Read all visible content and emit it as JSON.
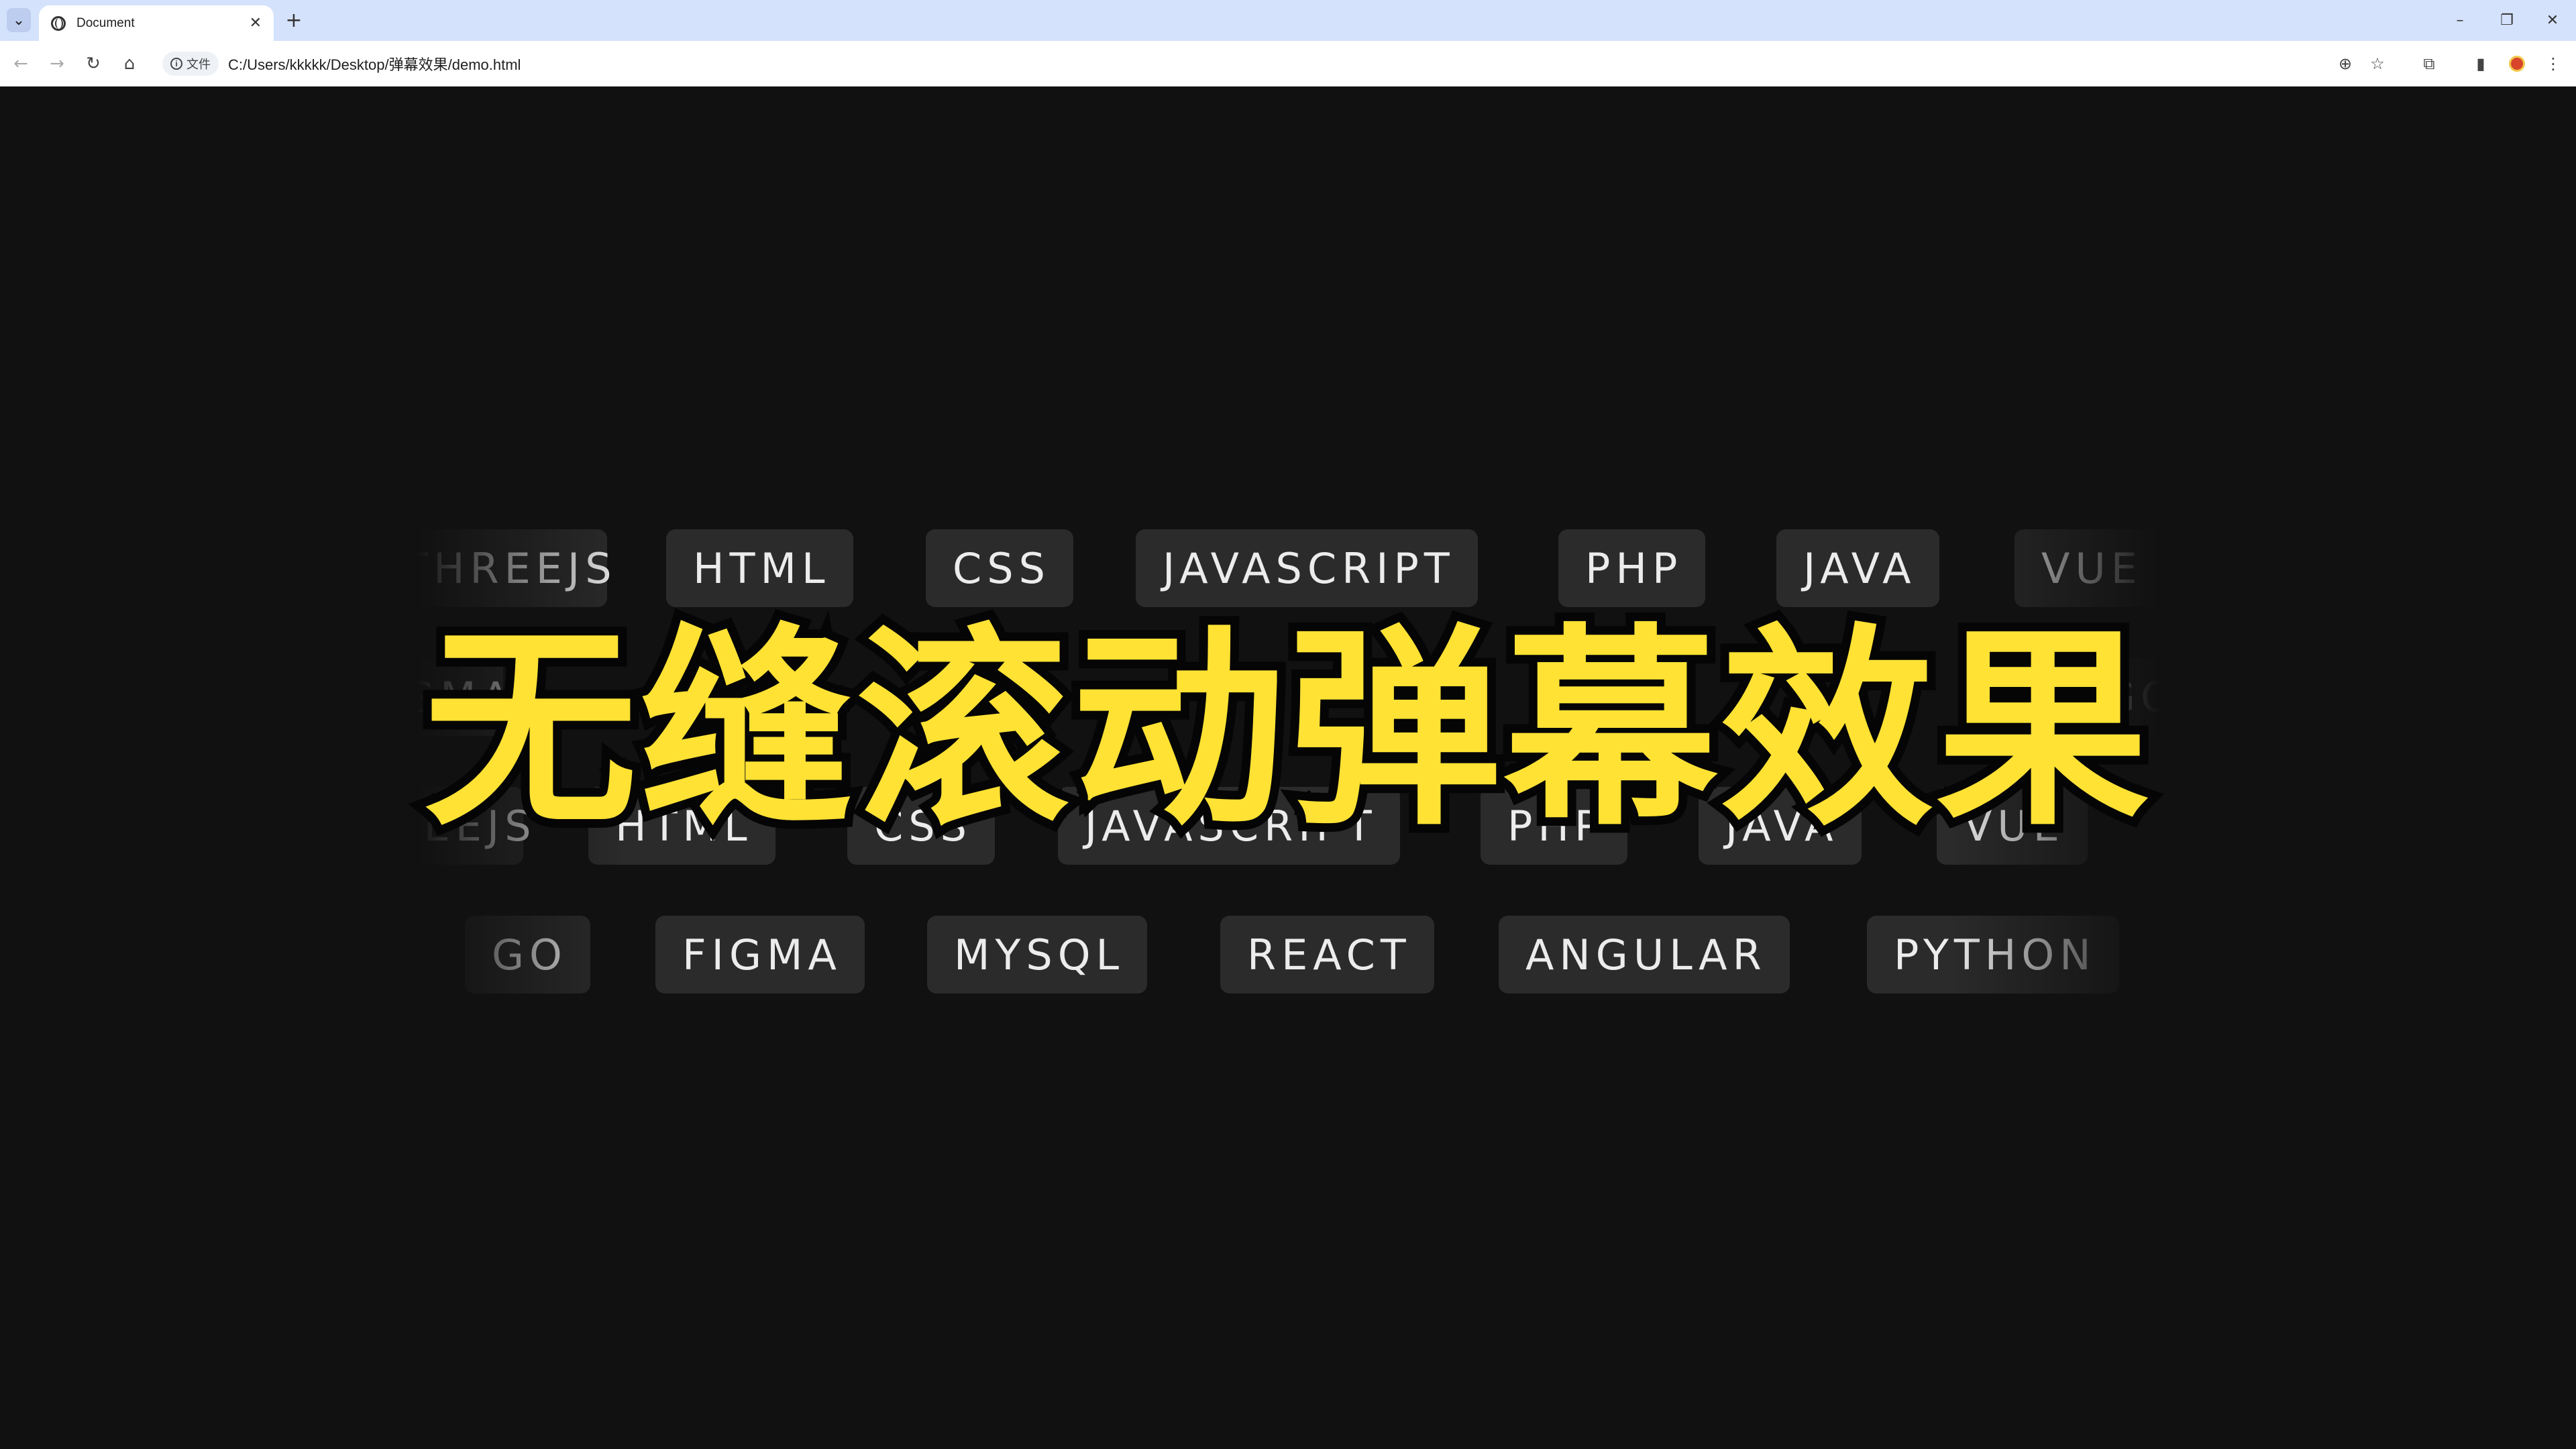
{
  "browser": {
    "tab_title": "Document",
    "site_chip_label": "文件",
    "url": "C:/Users/kkkkk/Desktop/弹幕效果/demo.html",
    "icons": [
      "tab-search-icon",
      "favicon-globe-icon",
      "close-icon",
      "new-tab-icon",
      "minimize-icon",
      "restore-icon",
      "window-close-icon",
      "back-icon",
      "forward-icon",
      "reload-icon",
      "home-icon",
      "info-icon",
      "zoom-icon",
      "star-icon",
      "extensions-icon",
      "side-panel-icon",
      "profile-avatar",
      "menu-icon"
    ]
  },
  "page": {
    "headline": "无缝滚动弹幕效果",
    "headline_color": "#ffe234",
    "background_color": "#111111",
    "chip_color": "#2b2b2b",
    "rows": [
      {
        "chips": [
          "THREEJS",
          "HTML",
          "CSS",
          "JAVASCRIPT",
          "PHP",
          "JAVA",
          "VUE"
        ]
      },
      {
        "chips": [
          "FIGMA",
          "GO"
        ]
      },
      {
        "chips": [
          "THREEJS",
          "HTML",
          "CSS",
          "JAVASCRIPT",
          "PHP",
          "JAVA",
          "VUE"
        ]
      },
      {
        "chips": [
          "GO",
          "FIGMA",
          "MYSQL",
          "REACT",
          "ANGULAR",
          "PYTHON"
        ]
      }
    ]
  }
}
